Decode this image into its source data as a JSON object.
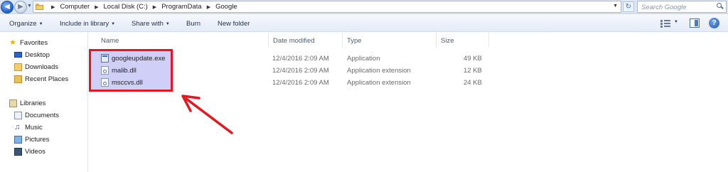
{
  "window": {
    "breadcrumbs": [
      "Computer",
      "Local Disk (C:)",
      "ProgramData",
      "Google"
    ],
    "search_placeholder": "Search Google"
  },
  "toolbar": {
    "organize": "Organize",
    "include_in_library": "Include in library",
    "share_with": "Share with",
    "burn": "Burn",
    "new_folder": "New folder"
  },
  "sidebar": {
    "favorites_header": "Favorites",
    "favorites": [
      "Desktop",
      "Downloads",
      "Recent Places"
    ],
    "libraries_header": "Libraries",
    "libraries": [
      "Documents",
      "Music",
      "Pictures",
      "Videos"
    ]
  },
  "columns": {
    "name": "Name",
    "date_modified": "Date modified",
    "type": "Type",
    "size": "Size"
  },
  "files": [
    {
      "name": "googleupdate.exe",
      "date": "12/4/2016 2:09 AM",
      "type": "Application",
      "size": "49 KB",
      "icon": "exe-icon"
    },
    {
      "name": "malib.dll",
      "date": "12/4/2016 2:09 AM",
      "type": "Application extension",
      "size": "12 KB",
      "icon": "dll-icon"
    },
    {
      "name": "msccvs.dll",
      "date": "12/4/2016 2:09 AM",
      "type": "Application extension",
      "size": "24 KB",
      "icon": "dll-icon"
    }
  ],
  "annotation": {
    "highlight_color": "#e8141e",
    "arrow_color": "#e8141e"
  }
}
